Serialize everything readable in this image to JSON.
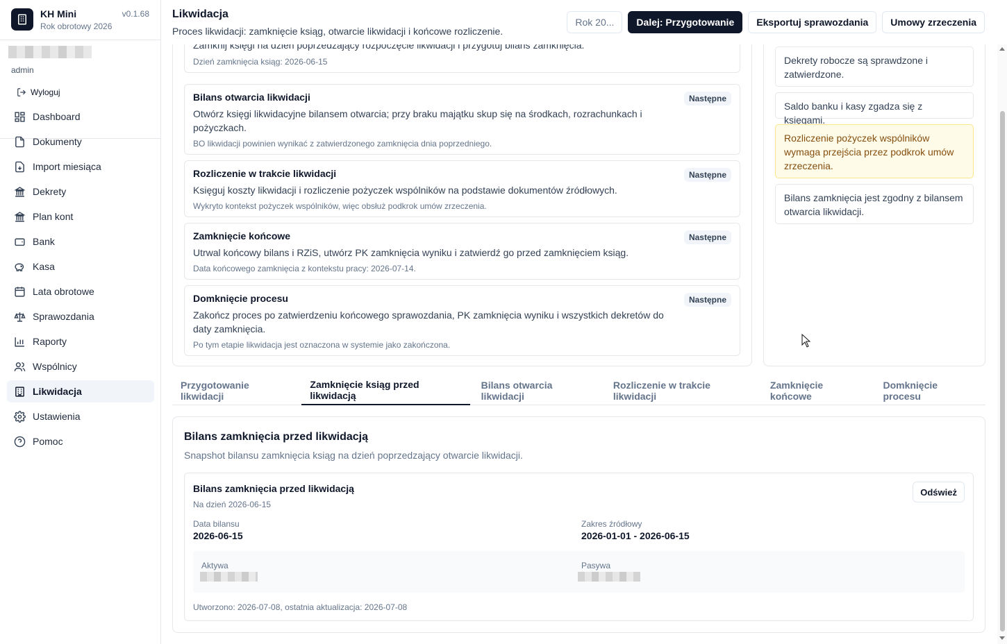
{
  "app": {
    "name": "KH Mini",
    "year_label": "Rok obrotowy 2026",
    "version": "v0.1.68",
    "user_role": "admin",
    "logout_label": "Wyloguj"
  },
  "nav": {
    "items": [
      {
        "label": "Dashboard",
        "icon": "dashboard-icon"
      },
      {
        "label": "Dokumenty",
        "icon": "document-icon"
      },
      {
        "label": "Import miesiąca",
        "icon": "import-icon"
      },
      {
        "label": "Dekrety",
        "icon": "bank-building-icon"
      },
      {
        "label": "Plan kont",
        "icon": "bank-building-icon"
      },
      {
        "label": "Bank",
        "icon": "wallet-icon"
      },
      {
        "label": "Kasa",
        "icon": "piggy-bank-icon"
      },
      {
        "label": "Lata obrotowe",
        "icon": "calendar-icon"
      },
      {
        "label": "Sprawozdania",
        "icon": "scale-icon"
      },
      {
        "label": "Raporty",
        "icon": "bar-chart-icon"
      },
      {
        "label": "Wspólnicy",
        "icon": "users-icon"
      },
      {
        "label": "Likwidacja",
        "icon": "building-icon"
      },
      {
        "label": "Ustawienia",
        "icon": "gear-icon"
      },
      {
        "label": "Pomoc",
        "icon": "help-icon"
      }
    ],
    "active": "Likwidacja"
  },
  "header": {
    "title": "Likwidacja",
    "subtitle": "Proces likwidacji: zamknięcie ksiąg, otwarcie likwidacji i końcowe rozliczenie.",
    "year_button": "Rok 20...",
    "next_button": "Dalej: Przygotowanie",
    "export_button": "Eksportuj sprawozdania",
    "agreements_button": "Umowy zrzeczenia"
  },
  "steps": {
    "first_partial": {
      "desc": "Zamknij księgi na dzień poprzedzający rozpoczęcie likwidacji i przygotuj bilans zamknięcia.",
      "note": "Dzień zamknięcia ksiąg: 2026-06-15"
    },
    "items": [
      {
        "title": "Bilans otwarcia likwidacji",
        "desc": "Otwórz księgi likwidacyjne bilansem otwarcia; przy braku majątku skup się na środkach, rozrachunkach i pożyczkach.",
        "note": "BO likwidacji powinien wynikać z zatwierdzonego zamknięcia dnia poprzedniego.",
        "badge": "Następne"
      },
      {
        "title": "Rozliczenie w trakcie likwidacji",
        "desc": "Księguj koszty likwidacji i rozliczenie pożyczek wspólników na podstawie dokumentów źródłowych.",
        "note": "Wykryto kontekst pożyczek wspólników, więc obsłuż podkrok umów zrzeczenia.",
        "badge": "Następne"
      },
      {
        "title": "Zamknięcie końcowe",
        "desc": "Utrwal końcowy bilans i RZiS, utwórz PK zamknięcia wyniku i zatwierdź go przed zamknięciem ksiąg.",
        "note": "Data końcowego zamknięcia z kontekstu pracy: 2026-07-14.",
        "badge": "Następne"
      },
      {
        "title": "Domknięcie procesu",
        "desc": "Zakończ proces po zatwierdzeniu końcowego sprawozdania, PK zamknięcia wyniku i wszystkich dekretów do daty zamknięcia.",
        "note": "Po tym etapie likwidacja jest oznaczona w systemie jako zakończona.",
        "badge": "Następne"
      }
    ]
  },
  "checks": [
    {
      "text": "Dekrety robocze są sprawdzone i zatwierdzone.",
      "warn": false
    },
    {
      "text": "Saldo banku i kasy zgadza się z księgami.",
      "warn": false
    },
    {
      "text": "Rozliczenie pożyczek wspólników wymaga przejścia przez podkrok umów zrzeczenia.",
      "warn": true
    },
    {
      "text": "Bilans zamknięcia jest zgodny z bilansem otwarcia likwidacji.",
      "warn": false
    }
  ],
  "tabs": [
    "Przygotowanie likwidacji",
    "Zamknięcie ksiąg przed likwidacją",
    "Bilans otwarcia likwidacji",
    "Rozliczenie w trakcie likwidacji",
    "Zamknięcie końcowe",
    "Domknięcie procesu"
  ],
  "active_tab": "Zamknięcie ksiąg przed likwidacją",
  "detail": {
    "title": "Bilans zamknięcia przed likwidacją",
    "subtitle": "Snapshot bilansu zamknięcia ksiąg na dzień poprzedzający otwarcie likwidacji.",
    "inner_title": "Bilans zamknięcia przed likwidacją",
    "inner_date": "Na dzień 2026-06-15",
    "refresh_label": "Odśwież",
    "date_label": "Data bilansu",
    "date_value": "2026-06-15",
    "range_label": "Zakres źródłowy",
    "range_value": "2026-01-01 - 2026-06-15",
    "assets_label": "Aktywa",
    "liabilities_label": "Pasywa",
    "created": "Utworzono: 2026-07-08, ostatnia aktualizacja: 2026-07-08"
  },
  "colors": {
    "primary": "#0f172a",
    "warn_bg": "#fefce8",
    "warn_text": "#854d0e",
    "active_nav_bg": "#f1f5f9"
  }
}
